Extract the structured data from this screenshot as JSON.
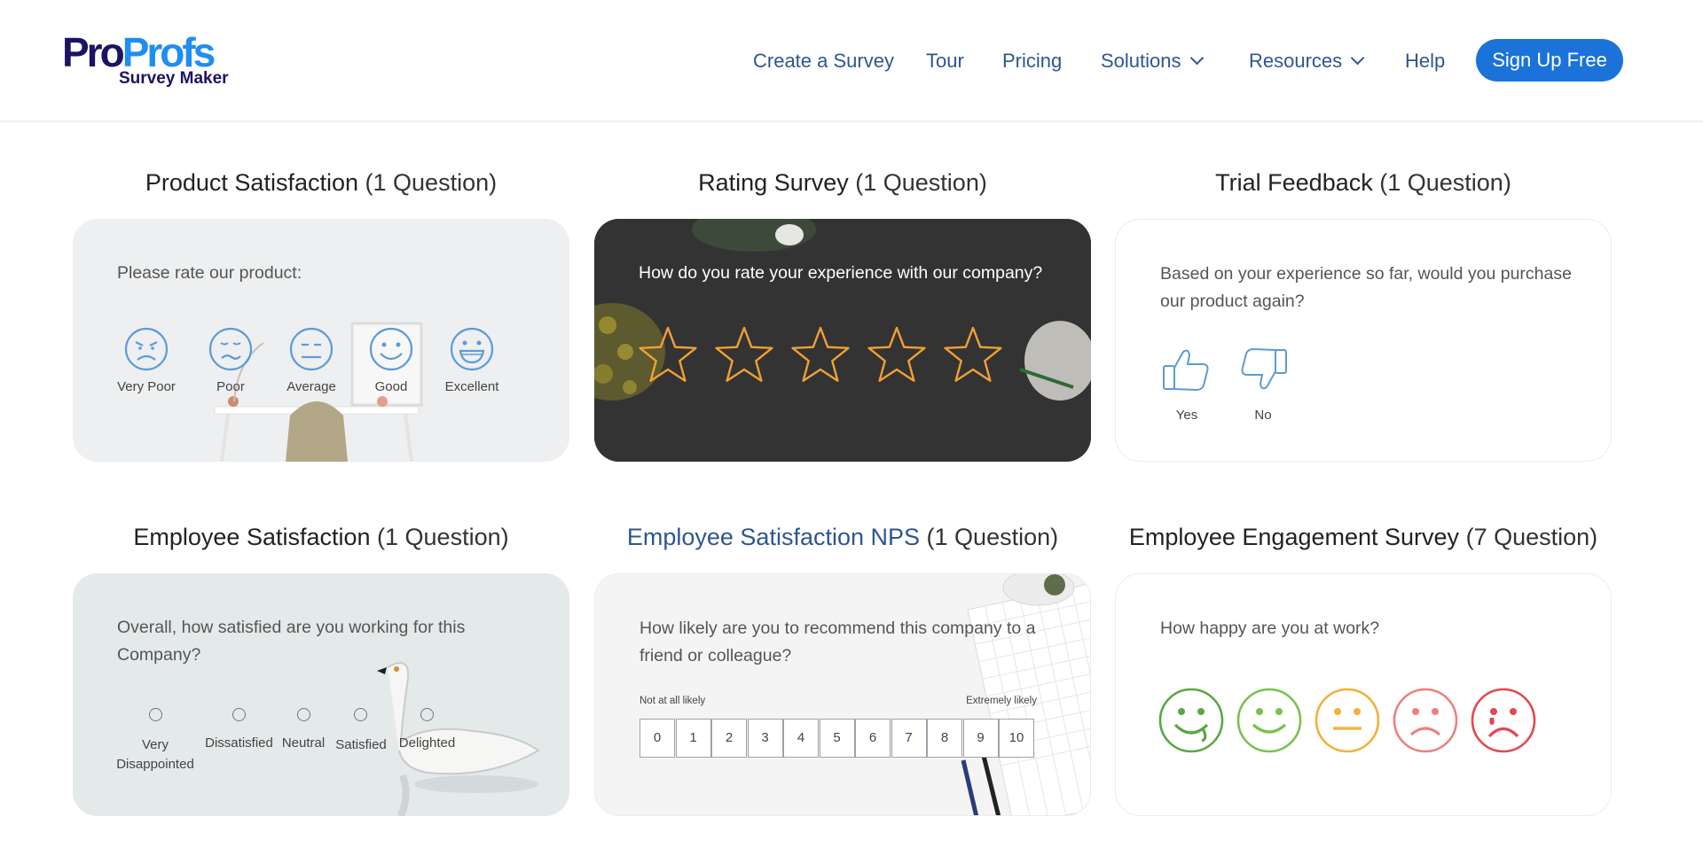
{
  "logo": {
    "word_a": "Pro",
    "word_b": "Profs",
    "sub": "Survey Maker"
  },
  "nav": {
    "items": [
      {
        "label": "Create a Survey"
      },
      {
        "label": "Tour"
      },
      {
        "label": "Pricing"
      },
      {
        "label": "Solutions"
      },
      {
        "label": "Resources"
      },
      {
        "label": "Help"
      }
    ],
    "cta": "Sign Up Free"
  },
  "cards": [
    {
      "name": "Product Satisfaction",
      "count": "(1 Question)",
      "question": "Please rate our product:",
      "options": [
        "Very Poor",
        "Poor",
        "Average",
        "Good",
        "Excellent"
      ]
    },
    {
      "name": "Rating Survey",
      "count": "(1 Question)",
      "question": "How do you rate your experience with our company?",
      "stars": 5
    },
    {
      "name": "Trial Feedback",
      "count": "(1 Question)",
      "question": "Based on your experience so far, would you purchase our product again?",
      "options": [
        "Yes",
        "No"
      ]
    },
    {
      "name": "Employee Satisfaction",
      "count": "(1 Question)",
      "question": "Overall, how satisfied are you working for this Company?",
      "options": [
        "Very Disappointed",
        "Dissatisfied",
        "Neutral",
        "Satisfied",
        "Delighted"
      ]
    },
    {
      "name": "Employee Satisfaction NPS",
      "count": "(1 Question)",
      "question": "How likely are you to recommend this company to a friend or colleague?",
      "scale_low": "Not at all likely",
      "scale_high": "Extremely likely",
      "scale": [
        "0",
        "1",
        "2",
        "3",
        "4",
        "5",
        "6",
        "7",
        "8",
        "9",
        "10"
      ]
    },
    {
      "name": "Employee Engagement Survey",
      "count": "(7 Question)",
      "question": "How happy are you at work?",
      "face_colors": [
        "#5aa744",
        "#78c24e",
        "#f2b13a",
        "#ee7f7f",
        "#e2484f"
      ]
    }
  ],
  "colors": {
    "nav_text": "#2d5791",
    "cta_bg": "#1b73d9",
    "star": "#f0a033",
    "face_line": "#5b9bd8"
  }
}
